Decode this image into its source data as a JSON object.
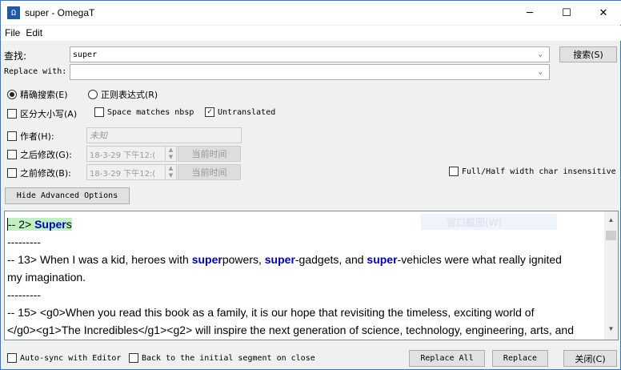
{
  "window": {
    "title": "super - OmegaT",
    "minimize": "─",
    "maximize": "☐",
    "close": "✕"
  },
  "menu": [
    "File",
    "Edit"
  ],
  "find": {
    "label": "查找:",
    "value": "super",
    "button": "搜索(S)"
  },
  "replace": {
    "label": "Replace with:",
    "value": ""
  },
  "mode": {
    "exact": "精确搜索(E)",
    "regex": "正则表达式(R)",
    "selected": "exact"
  },
  "options": {
    "case": "区分大小写(A)",
    "nbsp": "Space matches nbsp",
    "untranslated": "Untranslated",
    "untranslated_checked": true
  },
  "author": {
    "label": "作者(H):",
    "placeholder": "未知"
  },
  "after": {
    "label": "之后修改(G):",
    "value": "18-3-29 下午12:(",
    "now": "当前时间"
  },
  "before": {
    "label": "之前修改(B):",
    "value": "18-3-29 下午12:(",
    "now": "当前时间"
  },
  "fullhalf": "Full/Half width char insensitive",
  "hide_button": "Hide Advanced Options",
  "ghost": "窗口截图(W)",
  "results": {
    "r1_pre": "-- 2> ",
    "r1_hl": "Super",
    "r1_post": "s",
    "sep": "---------",
    "r2": [
      "-- 13> When I was a kid, heroes with ",
      "super",
      "powers, ",
      "super",
      "-gadgets, and ",
      "super",
      "-vehicles were what really ignited"
    ],
    "r2b": "my imagination.",
    "r3a": "-- 15> <g0>When you read this book as a family, it is our hope that revisiting the timeless, exciting world of",
    "r3b": "</g0><g1>The Incredibles</g1><g2> will inspire the next generation of science, technology, engineering, arts, and"
  },
  "footer": {
    "autosync": "Auto-sync with Editor",
    "back": "Back to the initial segment on close",
    "replace_all": "Replace All",
    "replace": "Replace",
    "close": "关闭(C)"
  }
}
